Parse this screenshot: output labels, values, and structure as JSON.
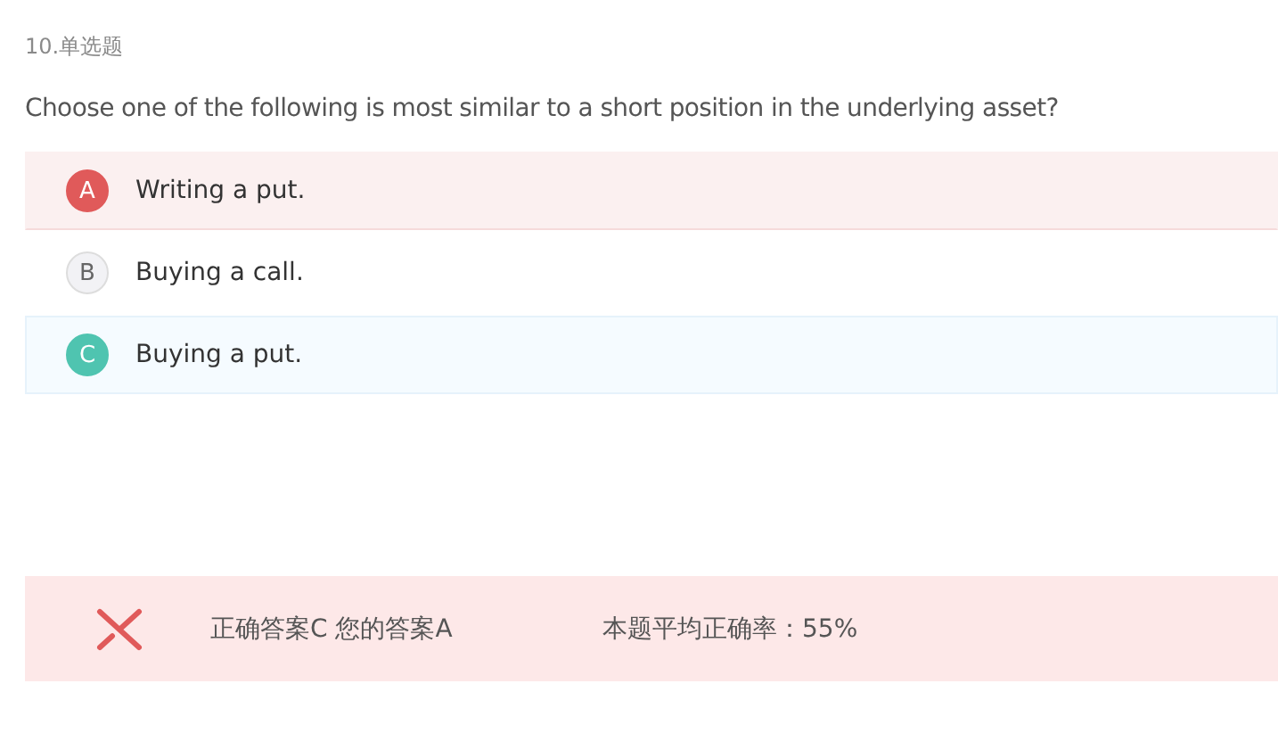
{
  "question_label": "10.单选题",
  "question": "Choose one of the following is most similar to a short position in the underlying asset?",
  "options": [
    {
      "letter": "A",
      "text": "Writing a put.",
      "selected": true,
      "correct": false
    },
    {
      "letter": "B",
      "text": "Buying a call.",
      "selected": false,
      "correct": false
    },
    {
      "letter": "C",
      "text": "Buying a put.",
      "selected": false,
      "correct": true
    }
  ],
  "result": {
    "answered_correctly": false,
    "answer_text": "正确答案C 您的答案A",
    "accuracy_text": "本题平均正确率：55%"
  }
}
